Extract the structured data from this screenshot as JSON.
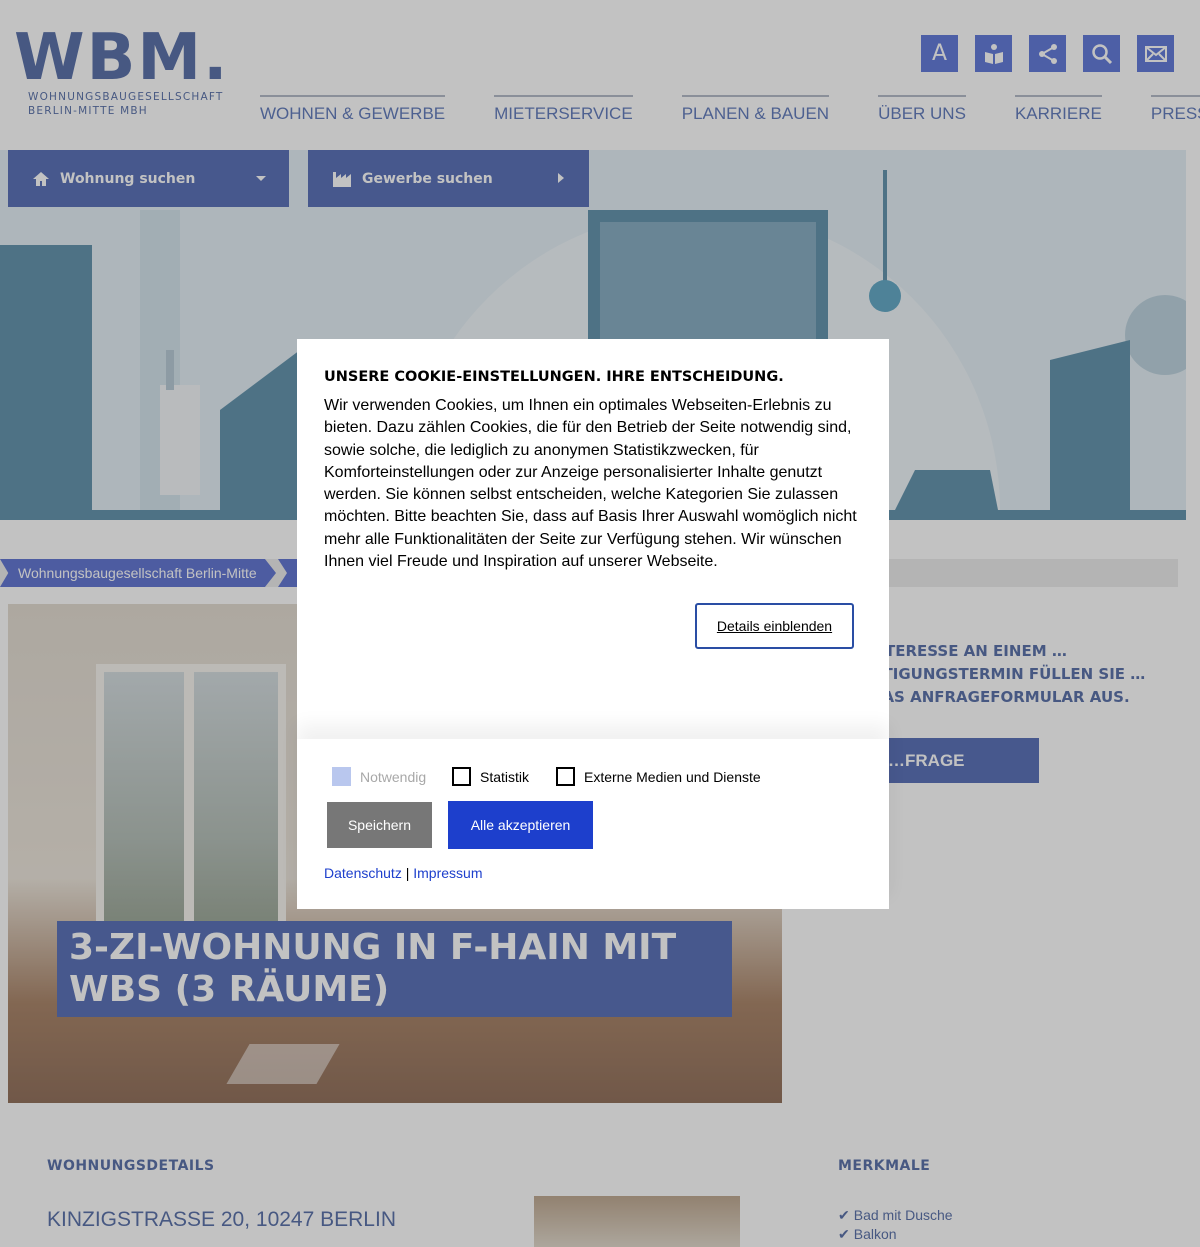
{
  "header": {
    "logo_text": "WBM.",
    "logo_sub_1": "WOHNUNGSBAUGESELLSCHAFT",
    "logo_sub_2": "BERLIN-MITTE MBH",
    "nav": [
      "WOHNEN & GEWERBE",
      "MIETERSERVICE",
      "PLANEN & BAUEN",
      "ÜBER UNS",
      "KARRIERE",
      "PRESSE"
    ],
    "icons": [
      "font-size-icon",
      "easy-language-icon",
      "share-icon",
      "search-icon",
      "mail-icon"
    ],
    "icon_letter": "A"
  },
  "hero": {
    "search_apartment": "Wohnung suchen",
    "search_commercial": "Gewerbe suchen"
  },
  "breadcrumb": {
    "home": "Wohnungsbaugesellschaft Berlin-Mitte"
  },
  "listing": {
    "title": "3-ZI-WOHNUNG IN F-HAIN MIT WBS (3 RÄUME)",
    "side_text": "…TERESSE AN EINEM …HTIGUNGSTERMIN FÜLLEN SIE …DAS ANFRAGEFORMULAR AUS.",
    "side_button": "…FRAGE SENDEN",
    "details_heading": "WOHNUNGSDETAILS",
    "address": "KINZIGSTRASSE 20, 10247 BERLIN",
    "features_heading": "MERKMALE",
    "features": [
      "Bad mit Dusche",
      "Balkon"
    ]
  },
  "cookie": {
    "title": "UNSERE COOKIE-EINSTELLUNGEN. IHRE ENTSCHEIDUNG.",
    "body": "Wir verwenden Cookies, um Ihnen ein optimales Webseiten-Erlebnis zu bieten. Dazu zählen Cookies, die für den Betrieb der Seite notwendig sind, sowie solche, die lediglich zu anonymen Statistikzwecken, für Komforteinstellungen oder zur Anzeige personalisierter Inhalte genutzt werden. Sie können selbst entscheiden, welche Kategorien Sie zulassen möchten. Bitte beachten Sie, dass auf Basis Ihrer Auswahl womöglich nicht mehr alle Funktionalitäten der Seite zur Verfügung stehen. Wir wünschen Ihnen viel Freude und Inspiration auf unserer Webseite.",
    "details_button": "Details einblenden",
    "options": {
      "necessary": "Notwendig",
      "statistics": "Statistik",
      "external": "Externe Medien und Dienste"
    },
    "save": "Speichern",
    "accept_all": "Alle akzeptieren",
    "privacy": "Datenschutz",
    "separator": "|",
    "imprint": "Impressum"
  },
  "colors": {
    "brand_blue": "#1f3f9e",
    "accent_blue": "#1d3fcc",
    "overlay": "rgba(120,120,120,0.45)"
  }
}
